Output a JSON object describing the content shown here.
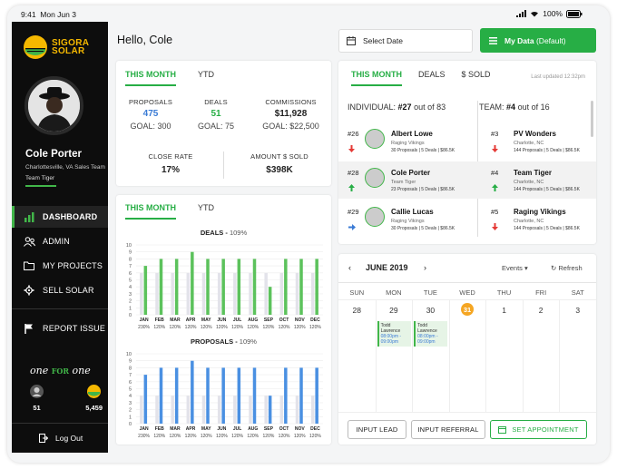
{
  "status": {
    "time": "9:41",
    "date": "Mon Jun 3",
    "battery": "100%"
  },
  "brand": {
    "line1": "SIGORA",
    "line2": "SOLAR"
  },
  "user": {
    "name": "Cole Porter",
    "location": "Charlottesville, VA Sales Team",
    "team": "Team Tiger"
  },
  "nav": [
    {
      "label": "DASHBOARD",
      "icon": "bar-chart-icon",
      "active": true
    },
    {
      "label": "ADMIN",
      "icon": "users-icon",
      "active": false
    },
    {
      "label": "MY PROJECTS",
      "icon": "folder-icon",
      "active": false
    },
    {
      "label": "SELL SOLAR",
      "icon": "gear-icon",
      "active": false
    },
    {
      "label": "REPORT ISSUE",
      "icon": "flag-icon",
      "active": false
    }
  ],
  "oneforone": {
    "a": "one",
    "b": "FOR",
    "c": "one",
    "items": [
      {
        "value": "51",
        "icon": "person-icon"
      },
      {
        "value": "5,459",
        "icon": "sun-icon"
      }
    ]
  },
  "logout": "Log Out",
  "greeting": "Hello, Cole",
  "select_date": "Select Date",
  "my_data": {
    "label": "My Data",
    "detail": "(Default)"
  },
  "summary": {
    "tabs": [
      "THIS MONTH",
      "YTD"
    ],
    "proposals": {
      "label": "PROPOSALS",
      "value": "475",
      "goal": "GOAL: 300"
    },
    "deals": {
      "label": "DEALS",
      "value": "51",
      "goal": "GOAL: 75"
    },
    "commissions": {
      "label": "COMMISSIONS",
      "value": "$11,928",
      "goal": "GOAL: $22,500"
    },
    "close_rate": {
      "label": "CLOSE RATE",
      "value": "17%"
    },
    "amount_sold": {
      "label": "AMOUNT $ SOLD",
      "value": "$398K"
    }
  },
  "charts_card": {
    "tabs": [
      "THIS MONTH",
      "YTD"
    ]
  },
  "chart_data": [
    {
      "type": "bar",
      "title": "DEALS",
      "subtitle": "109%",
      "categories": [
        "JAN",
        "FEB",
        "MAR",
        "APR",
        "MAY",
        "JUN",
        "JUL",
        "AUG",
        "SEP",
        "OCT",
        "NOV",
        "DEC"
      ],
      "series": [
        {
          "name": "goal",
          "values": [
            6,
            6,
            6,
            6,
            6,
            6,
            6,
            6,
            6,
            6,
            6,
            6
          ]
        },
        {
          "name": "actual",
          "values": [
            7,
            8,
            8,
            9,
            8,
            8,
            8,
            8,
            4,
            8,
            8,
            8
          ]
        }
      ],
      "percent_labels": [
        "230%",
        "120%",
        "120%",
        "120%",
        "120%",
        "120%",
        "120%",
        "120%",
        "120%",
        "120%",
        "120%",
        "120%"
      ],
      "ylim": [
        0,
        10
      ],
      "yticks": [
        0,
        1,
        2,
        3,
        4,
        5,
        6,
        7,
        8,
        9,
        10
      ],
      "color": "#5cc25c"
    },
    {
      "type": "bar",
      "title": "PROPOSALS",
      "subtitle": "109%",
      "categories": [
        "JAN",
        "FEB",
        "MAR",
        "APR",
        "MAY",
        "JUN",
        "JUL",
        "AUG",
        "SEP",
        "OCT",
        "NOV",
        "DEC"
      ],
      "series": [
        {
          "name": "goal",
          "values": [
            4,
            4,
            4,
            4,
            4,
            4,
            4,
            4,
            4,
            4,
            4,
            4
          ]
        },
        {
          "name": "actual",
          "values": [
            7,
            8,
            8,
            9,
            8,
            8,
            8,
            8,
            4,
            8,
            8,
            8
          ]
        }
      ],
      "percent_labels": [
        "230%",
        "120%",
        "120%",
        "120%",
        "120%",
        "120%",
        "120%",
        "120%",
        "120%",
        "120%",
        "120%",
        "120%"
      ],
      "ylim": [
        0,
        10
      ],
      "yticks": [
        0,
        1,
        2,
        3,
        4,
        5,
        6,
        7,
        8,
        9,
        10
      ],
      "color": "#4a90e2"
    }
  ],
  "leaderboard": {
    "tabs": [
      "THIS MONTH",
      "DEALS",
      "$ SOLD"
    ],
    "updated": "Last updated 12:32pm",
    "individual": {
      "label": "INDIVIDUAL:",
      "rank": "#27",
      "suffix": "out of 83"
    },
    "team": {
      "label": "TEAM:",
      "rank": "#4",
      "suffix": "out of 16"
    },
    "people": [
      {
        "rank": "#26",
        "trend": "down",
        "name": "Albert Lowe",
        "sub": "Raging Vikings",
        "stats": "30 Proposals | 5 Deals | $86.5K"
      },
      {
        "rank": "#28",
        "trend": "up",
        "name": "Cole Porter",
        "sub": "Team Tiger",
        "stats": "23 Proposals | 5 Deals | $86.5K"
      },
      {
        "rank": "#29",
        "trend": "right",
        "name": "Callie Lucas",
        "sub": "Raging Vikings",
        "stats": "30 Proposals | 5 Deals | $86.5K"
      }
    ],
    "teams": [
      {
        "rank": "#3",
        "trend": "down",
        "name": "PV Wonders",
        "sub": "Charlotte, NC",
        "stats": "144 Proposals | 5 Deals | $86.5K"
      },
      {
        "rank": "#4",
        "trend": "up",
        "name": "Team Tiger",
        "sub": "Charlotte, NC",
        "stats": "144 Proposals | 5 Deals | $86.5K"
      },
      {
        "rank": "#5",
        "trend": "down",
        "name": "Raging Vikings",
        "sub": "Charlotte, NC",
        "stats": "144 Proposals | 5 Deals | $86.5K"
      }
    ]
  },
  "calendar": {
    "month": "JUNE 2019",
    "events_label": "Events",
    "refresh": "Refresh",
    "days": [
      "SUN",
      "MON",
      "TUE",
      "WED",
      "THU",
      "FRI",
      "SAT"
    ],
    "dates": [
      "28",
      "29",
      "30",
      "31",
      "1",
      "2",
      "3"
    ],
    "today_index": 3,
    "events": [
      {
        "day": 1,
        "name": "Todd Lawrence",
        "time": "08:00pm - 09:00pm"
      },
      {
        "day": 2,
        "name": "Todd Lawrence",
        "time": "08:00pm - 09:00pm"
      }
    ],
    "buttons": [
      "INPUT LEAD",
      "INPUT REFERRAL",
      "SET APPOINTMENT"
    ]
  }
}
